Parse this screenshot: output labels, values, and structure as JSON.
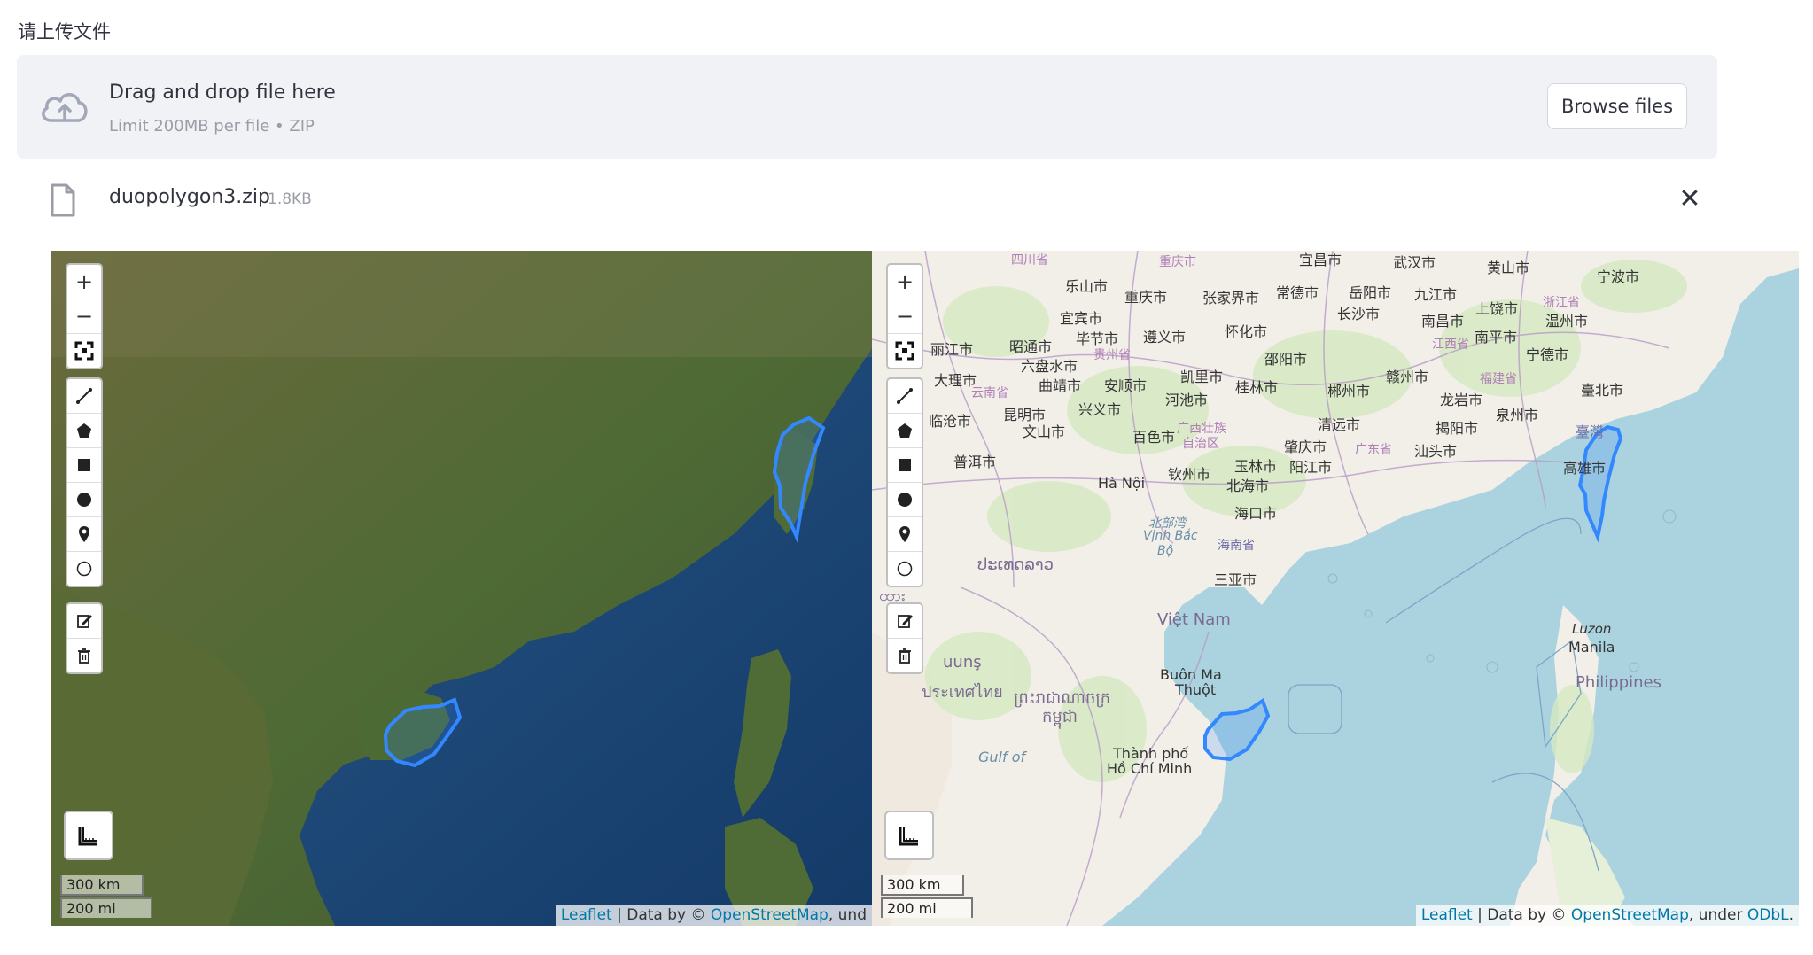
{
  "page": {
    "label": "请上传文件"
  },
  "uploader": {
    "title": "Drag and drop file here",
    "subtitle": "Limit 200MB per file • ZIP",
    "browse_label": "Browse files",
    "icon": "cloud-upload-icon"
  },
  "file": {
    "name": "duopolygon3.zip",
    "size": "1.8KB",
    "close": "✕",
    "icon": "file-icon"
  },
  "map_controls": {
    "zoom_in": "+",
    "zoom_out": "−",
    "tools": [
      "fullscreen-icon",
      "polyline-icon",
      "polygon-icon",
      "rectangle-icon",
      "circle-icon",
      "marker-icon",
      "circlemarker-icon",
      "edit-icon",
      "delete-icon",
      "measure-icon"
    ]
  },
  "left_map": {
    "basemap": "satellite",
    "scale_km": "300 km",
    "scale_mi": "200 mi",
    "attribution": {
      "leaflet": "Leaflet",
      "sep": " | Data by © ",
      "osm": "OpenStreetMap",
      "tail": ", und"
    }
  },
  "right_map": {
    "basemap": "openstreetmap",
    "scale_km": "300 km",
    "scale_mi": "200 mi",
    "attribution": {
      "leaflet": "Leaflet",
      "sep": " | Data by © ",
      "osm": "OpenStreetMap",
      "mid": ", under ",
      "odbl": "ODbL",
      "end": "."
    },
    "labels": {
      "sichuan": "四川省",
      "chongqing": "重庆市",
      "yichang": "宜昌市",
      "wuhan": "武汉市",
      "huangshan": "黄山市",
      "ningbo": "宁波市",
      "leshan": "乐山市",
      "chongqing2": "重庆市",
      "zhangjiajie": "张家界市",
      "changde": "常德市",
      "yueyang": "岳阳市",
      "jiujiang": "九江市",
      "shangrao": "上饶市",
      "zhejiang": "浙江省",
      "yibin": "宜宾市",
      "changsha": "长沙市",
      "nanchang": "南昌市",
      "wenzhou": "温州市",
      "bijie": "毕节市",
      "zunyi": "遵义市",
      "huaihua": "怀化市",
      "nanping": "南平市",
      "lijiang": "丽江市",
      "zhaotong": "昭通市",
      "guizhou": "贵州省",
      "shaoyang": "邵阳市",
      "jiangxi": "江西省",
      "ningde": "宁德市",
      "liupanshui": "六盘水市",
      "kaili": "凯里市",
      "ganzhou": "赣州市",
      "dali": "大理市",
      "qujing": "曲靖市",
      "anshun": "安顺市",
      "guilin": "桂林市",
      "fujian": "福建省",
      "taipei": "臺北市",
      "yunnan": "云南省",
      "hechi": "河池市",
      "chenzhou": "郴州市",
      "longyan": "龙岩市",
      "kunming": "昆明市",
      "xingyi": "兴义市",
      "quanzhou": "泉州市",
      "lincang": "临沧市",
      "guangxi": "广西壮族",
      "zizhiqu": "自治区",
      "qingyuan": "清远市",
      "jieyang": "揭阳市",
      "taiwan": "臺灣",
      "wenshan": "文山市",
      "baise": "百色市",
      "guangdong": "广东省",
      "shantou": "汕头市",
      "puer": "普洱市",
      "zhaoqing": "肇庆市",
      "kaohsiung": "高雄市",
      "yulin": "玉林市",
      "yangjiang": "阳江市",
      "hanoi": "Hà Nội",
      "qinzhou": "钦州市",
      "beihai": "北海市",
      "haikou": "海口市",
      "gulf": "北部湾",
      "vinhbac": "Vịnh Bắc",
      "bo": "Bộ",
      "hainan": "海南省",
      "sanya": "三亚市",
      "laos": "ປະເທດລາວ",
      "myanmar": "ထား",
      "vietnam": "Việt Nam",
      "luzon": "Luzon",
      "manila": "Manila",
      "thai": "uunş",
      "buonma": "Buôn Ma",
      "thuot": "Thuột",
      "thaicountry": "ประเทศไทย",
      "cambodia": "ព្រះរាជាណាចក្រ",
      "kampuchea": "កម្ពុជា",
      "philippines": "Philippines",
      "gulfof": "Gulf of",
      "thanhpho": "Thành phố",
      "hochiminh": "Hồ Chí Minh"
    }
  },
  "colors": {
    "accent": "#ff4b4b",
    "polygon": "#3388ff",
    "sea": "#aad3df",
    "land": "#f2efe9"
  }
}
